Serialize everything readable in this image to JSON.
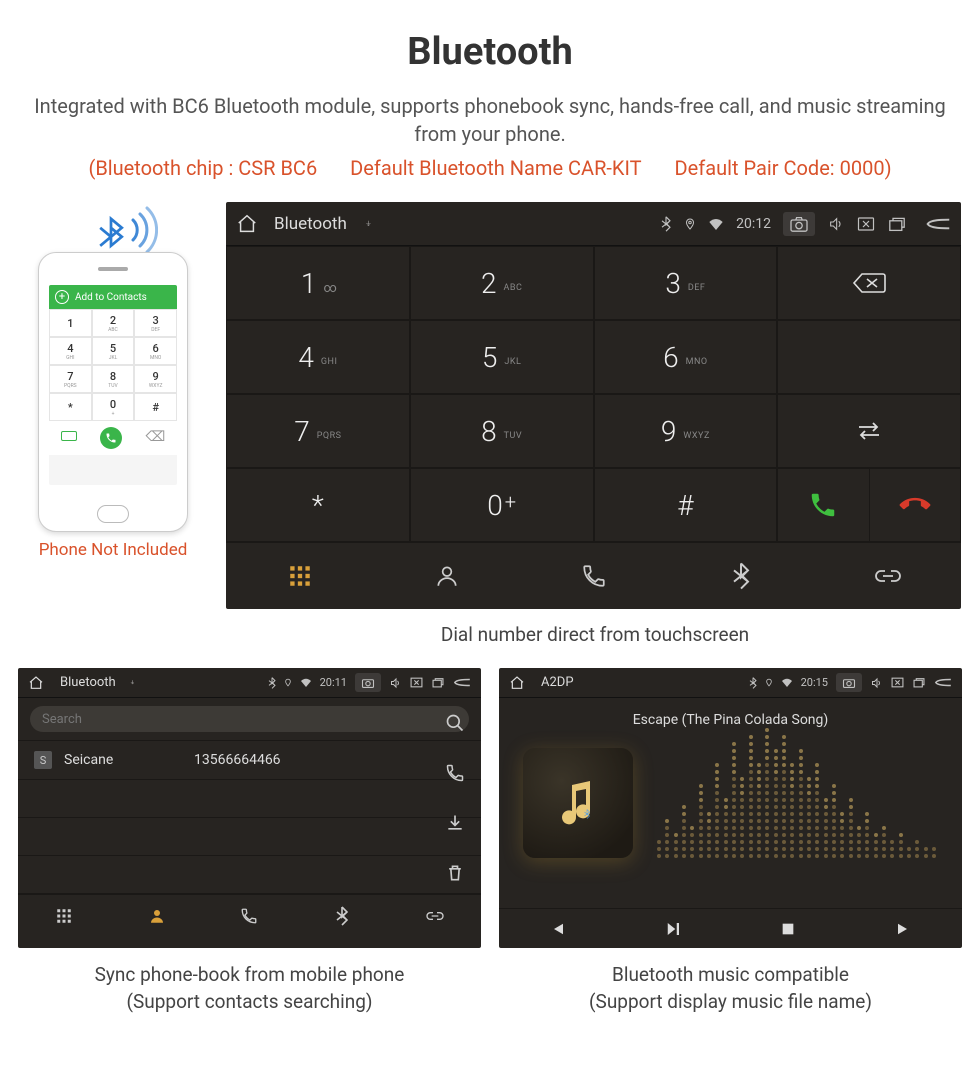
{
  "header": {
    "title": "Bluetooth",
    "desc": "Integrated with BC6 Bluetooth module, supports phonebook sync, hands-free call, and music streaming from your phone.",
    "spec_chip": "(Bluetooth chip : CSR BC6",
    "spec_name": "Default Bluetooth Name CAR-KIT",
    "spec_code": "Default Pair Code: 0000)"
  },
  "phone": {
    "bar_label": "Add to Contacts",
    "not_included": "Phone Not Included",
    "keys": [
      {
        "n": "1",
        "s": ""
      },
      {
        "n": "2",
        "s": "ABC"
      },
      {
        "n": "3",
        "s": "DEF"
      },
      {
        "n": "4",
        "s": "GHI"
      },
      {
        "n": "5",
        "s": "JKL"
      },
      {
        "n": "6",
        "s": "MNO"
      },
      {
        "n": "7",
        "s": "PQRS"
      },
      {
        "n": "8",
        "s": "TUV"
      },
      {
        "n": "9",
        "s": "WXYZ"
      },
      {
        "n": "*",
        "s": ""
      },
      {
        "n": "0",
        "s": "+"
      },
      {
        "n": "#",
        "s": ""
      }
    ]
  },
  "hu_dial": {
    "title": "Bluetooth",
    "time": "20:12",
    "keys": [
      {
        "n": "1",
        "l": "∞"
      },
      {
        "n": "2",
        "l": "ABC"
      },
      {
        "n": "3",
        "l": "DEF"
      },
      {
        "n": "4",
        "l": "GHI"
      },
      {
        "n": "5",
        "l": "JKL"
      },
      {
        "n": "6",
        "l": "MNO"
      },
      {
        "n": "7",
        "l": "PQRS"
      },
      {
        "n": "8",
        "l": "TUV"
      },
      {
        "n": "9",
        "l": "WXYZ"
      },
      {
        "n": "*",
        "l": ""
      },
      {
        "n": "0",
        "l": "+"
      },
      {
        "n": "#",
        "l": ""
      }
    ],
    "caption": "Dial number direct from touchscreen"
  },
  "hu_pb": {
    "title": "Bluetooth",
    "time": "20:11",
    "search_ph": "Search",
    "contact_tag": "S",
    "contact_name": "Seicane",
    "contact_num": "13566664466",
    "cap1": "Sync phone-book from mobile phone",
    "cap2": "(Support contacts searching)"
  },
  "hu_a2dp": {
    "title": "A2DP",
    "time": "20:15",
    "song": "Escape (The Pina Colada Song)",
    "cap1": "Bluetooth music compatible",
    "cap2": "(Support display music file name)",
    "viz_heights": [
      3,
      6,
      4,
      8,
      5,
      11,
      7,
      14,
      9,
      17,
      12,
      18,
      14,
      19,
      16,
      18,
      14,
      16,
      12,
      14,
      9,
      11,
      7,
      9,
      5,
      7,
      4,
      5,
      3,
      4,
      2,
      3,
      2,
      2
    ]
  },
  "colors": {
    "accent": "#d9522b",
    "call_green": "#3fbf3f",
    "call_red": "#d83a2a",
    "contact_active": "#d9a03a"
  }
}
